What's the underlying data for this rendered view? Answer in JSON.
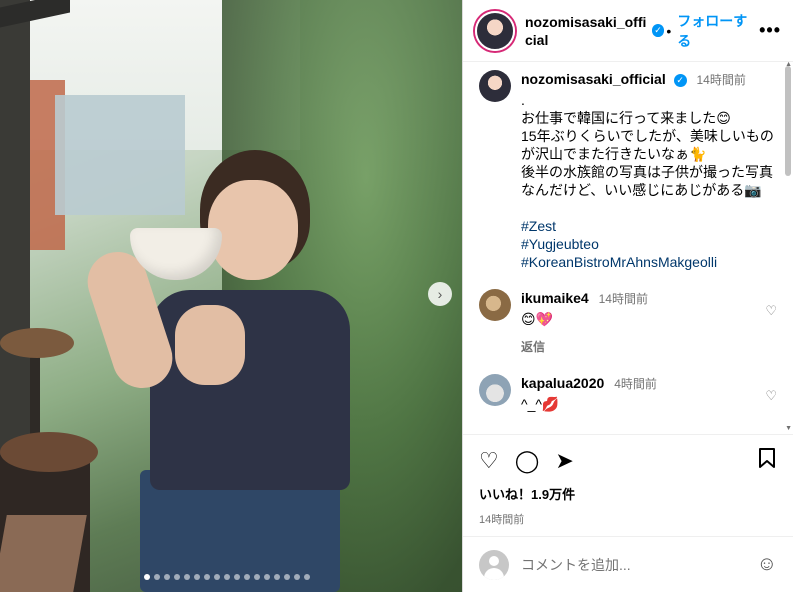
{
  "account": {
    "username": "nozomisasaki_official",
    "follow_label": "フォローする",
    "separator": "•",
    "more_label": "•••"
  },
  "caption": {
    "username": "nozomisasaki_official",
    "time": "14時間前",
    "text": ".\nお仕事で韓国に行って来ました😊\n15年ぶりくらいでしたが、美味しいものが沢山でまた行きたいなぁ🐈\n後半の水族館の写真は子供が撮った写真なんだけど、いい感じにあじがある📷",
    "hashtags": [
      "#Zest",
      "#Yugjeubteo",
      "#KoreanBistroMrAhnsMakgeolli"
    ]
  },
  "comments": [
    {
      "username": "ikumaike4",
      "time": "14時間前",
      "text": "😊💖",
      "reply_label": "返信"
    },
    {
      "username": "kapalua2020",
      "time": "4時間前",
      "text": "^_^💋"
    }
  ],
  "actions": {
    "likes": "いいね！1.9万件",
    "posted": "14時間前"
  },
  "add_comment": {
    "placeholder": "コメントを追加..."
  },
  "icons": {
    "verified": "✓",
    "heart": "♡",
    "comment": "◯",
    "share": "➤",
    "bookmark": "🔖",
    "emoji": "☺",
    "next": "›"
  },
  "media": {
    "slide_index": 1,
    "slide_count": 17
  },
  "colors": {
    "accent": "#0095f6",
    "hashtag": "#00376b",
    "muted": "#737373"
  }
}
